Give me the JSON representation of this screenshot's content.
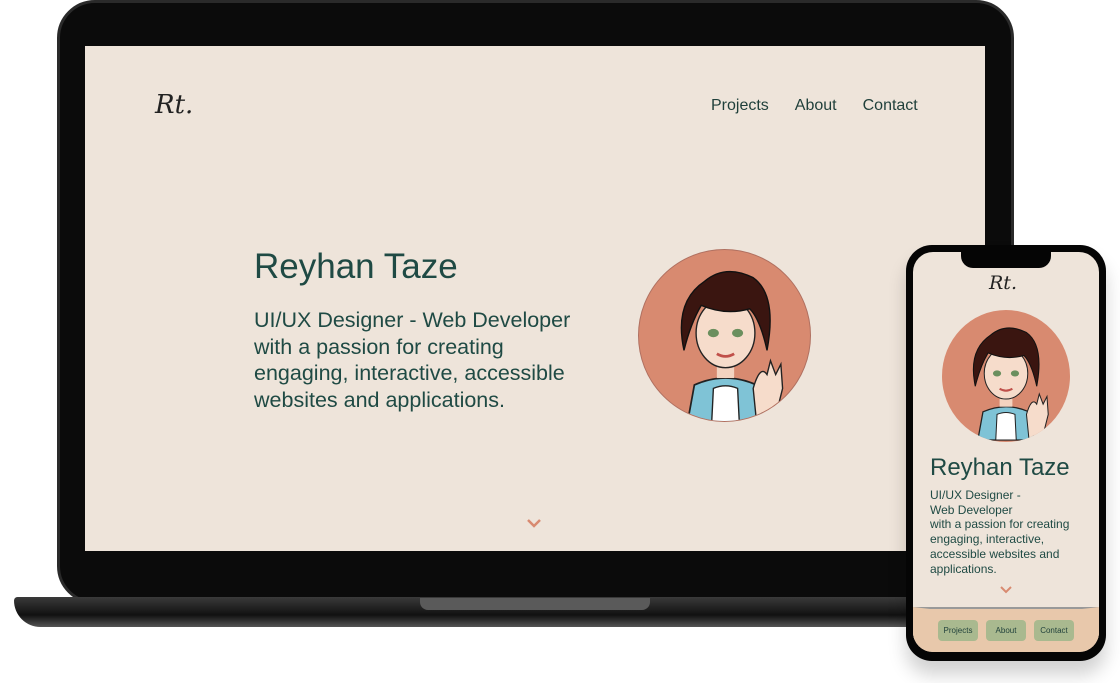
{
  "desktop": {
    "logo": "Rt.",
    "nav": [
      "Projects",
      "About",
      "Contact"
    ],
    "name": "Reyhan Taze",
    "tagline_lines": [
      "UI/UX Designer - Web Developer",
      "with a passion for creating",
      "engaging, interactive, accessible",
      "websites and applications."
    ],
    "scroll_icon": "chevron-down-icon"
  },
  "mobile": {
    "logo": "Rt.",
    "name": "Reyhan Taze",
    "tagline_lines": [
      "UI/UX Designer -",
      "Web Developer",
      "with a passion for creating",
      "engaging, interactive,",
      "accessible websites and",
      "applications."
    ],
    "nav": [
      "Projects",
      "About",
      "Contact"
    ]
  },
  "colors": {
    "background": "#eee4da",
    "accent": "#d88a70",
    "text": "#1f4a44",
    "mobile_nav_bg": "#e8c8ab",
    "mobile_button": "#a9b98f"
  }
}
